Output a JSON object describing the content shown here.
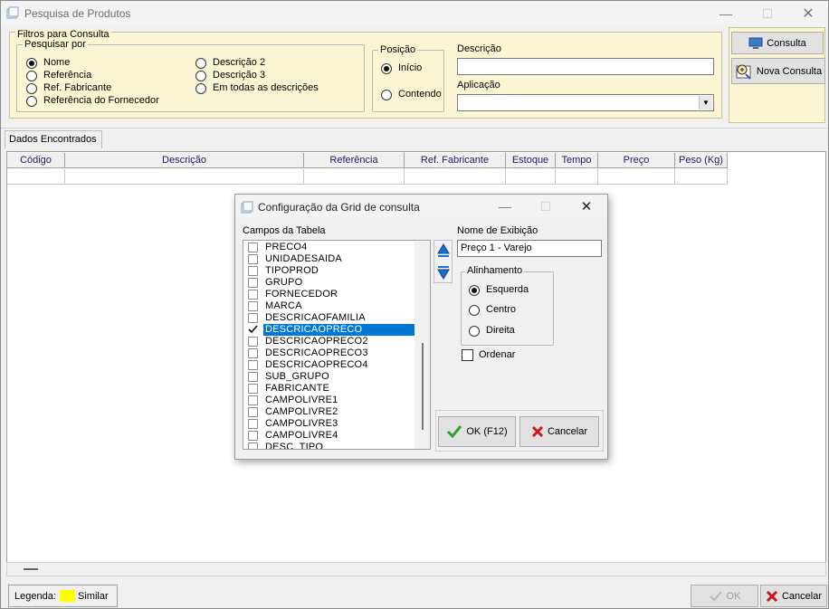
{
  "window": {
    "title": "Pesquisa de Produtos",
    "minimize": "—",
    "maximize": "☐",
    "close": "✕"
  },
  "filters": {
    "group_label": "Filtros para Consulta",
    "search_by_label": "Pesquisar por",
    "search_by_options": [
      "Nome",
      "Referência",
      "Ref. Fabricante",
      "Referência do Fornecedor",
      "Descrição 2",
      "Descrição 3",
      "Em todas as descrições"
    ],
    "selected_search_by": "Nome",
    "position_label": "Posição",
    "position_options": [
      "Início",
      "Contendo"
    ],
    "selected_position": "Início",
    "description_label": "Descrição",
    "description_value": "",
    "application_label": "Aplicação",
    "application_value": ""
  },
  "actions": {
    "consult": "Consulta",
    "new_consult": "Nova Consulta"
  },
  "results": {
    "tab": "Dados Encontrados",
    "columns": [
      "Código",
      "Descrição",
      "Referência",
      "Ref. Fabricante",
      "Estoque",
      "Tempo",
      "Preço",
      "Peso (Kg)"
    ]
  },
  "dialog": {
    "title": "Configuração da Grid de consulta",
    "fields_label": "Campos da Tabela",
    "fields": [
      {
        "name": "PRECO4",
        "checked": false
      },
      {
        "name": "UNIDADESAIDA",
        "checked": false
      },
      {
        "name": "TIPOPROD",
        "checked": false
      },
      {
        "name": "GRUPO",
        "checked": false
      },
      {
        "name": "FORNECEDOR",
        "checked": false
      },
      {
        "name": "MARCA",
        "checked": false
      },
      {
        "name": "DESCRICAOFAMILIA",
        "checked": false
      },
      {
        "name": "DESCRICAOPRECO",
        "checked": true,
        "selected": true
      },
      {
        "name": "DESCRICAOPRECO2",
        "checked": false
      },
      {
        "name": "DESCRICAOPRECO3",
        "checked": false
      },
      {
        "name": "DESCRICAOPRECO4",
        "checked": false
      },
      {
        "name": "SUB_GRUPO",
        "checked": false
      },
      {
        "name": "FABRICANTE",
        "checked": false
      },
      {
        "name": "CAMPOLIVRE1",
        "checked": false
      },
      {
        "name": "CAMPOLIVRE2",
        "checked": false
      },
      {
        "name": "CAMPOLIVRE3",
        "checked": false
      },
      {
        "name": "CAMPOLIVRE4",
        "checked": false
      },
      {
        "name": "DESC_TIPO",
        "checked": false
      }
    ],
    "display_name_label": "Nome de Exibição",
    "display_name_value": "Preço 1 - Varejo",
    "alignment_label": "Alinhamento",
    "alignment_options": [
      "Esquerda",
      "Centro",
      "Direita"
    ],
    "selected_alignment": "Esquerda",
    "order_label": "Ordenar",
    "ok_label": "OK (F12)",
    "cancel_label": "Cancelar"
  },
  "footer": {
    "legend_label": "Legenda:",
    "legend_color": "#ffff00",
    "legend_item": "Similar",
    "ok_label": "OK",
    "cancel_label": "Cancelar"
  },
  "colors": {
    "filter_panel": "#faf6d3",
    "selection": "#0078d7",
    "ok_green": "#2aa52a",
    "cancel_red": "#c8171e"
  }
}
